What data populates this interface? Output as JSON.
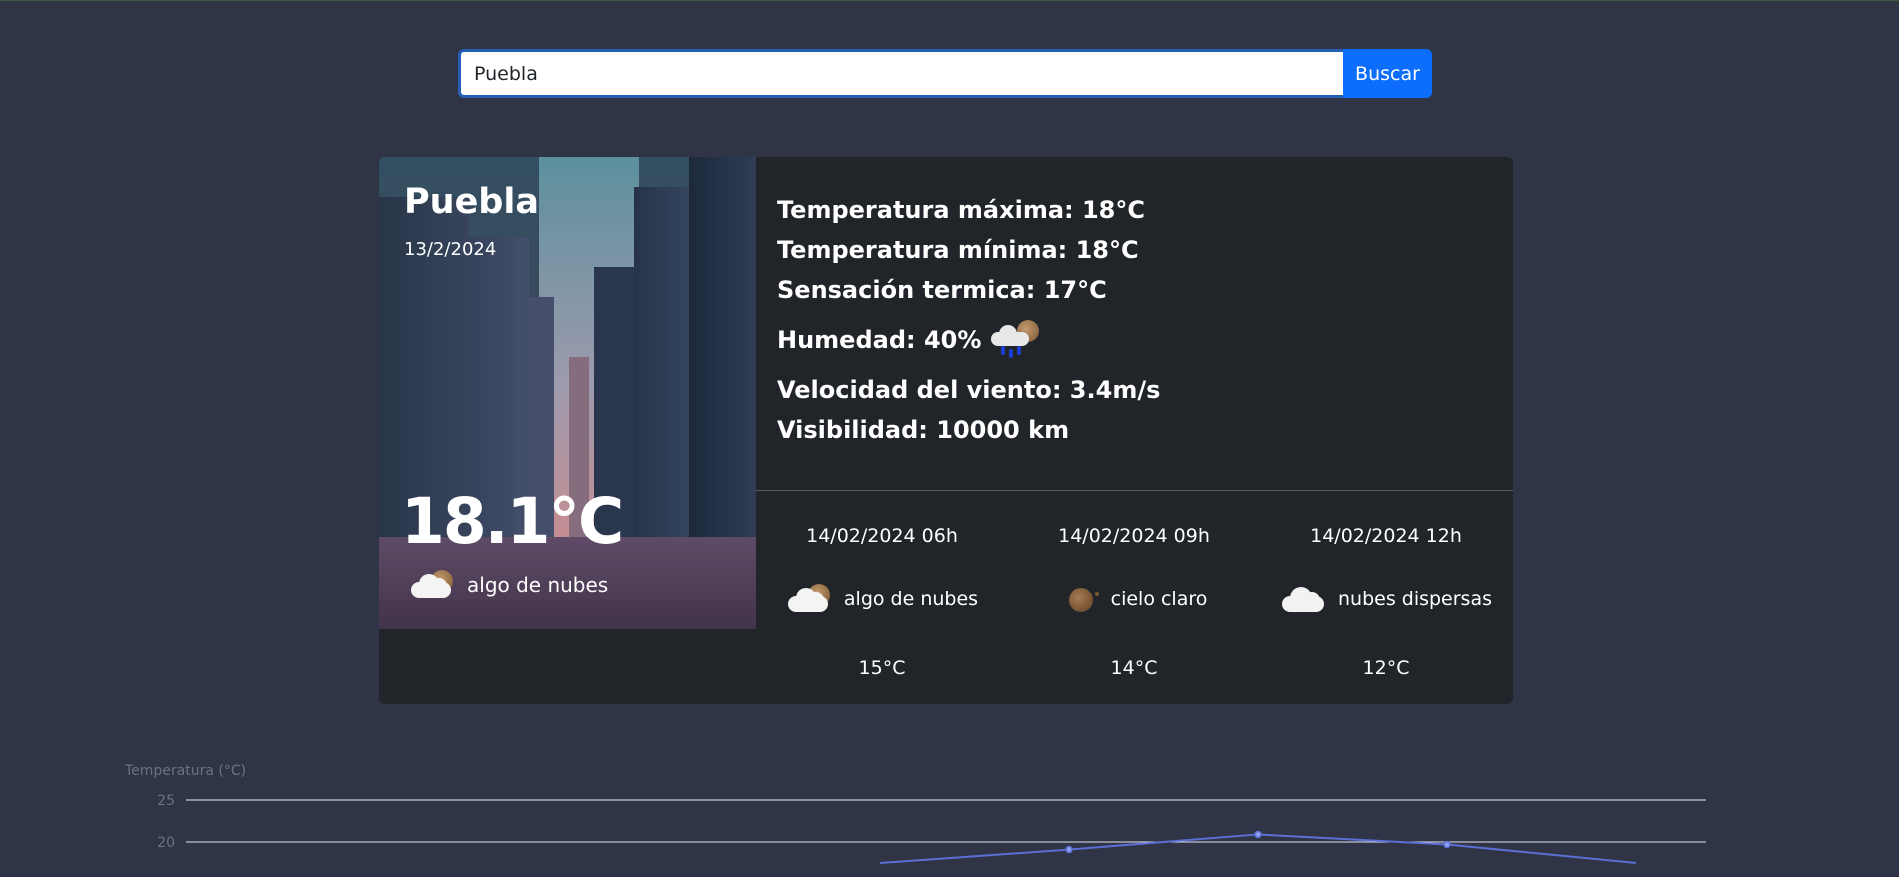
{
  "search": {
    "value": "Puebla",
    "button_label": "Buscar"
  },
  "current": {
    "city": "Puebla",
    "date": "13/2/2024",
    "temperature": "18.1°C",
    "description": "algo de nubes",
    "icon": "cloud-sun-icon"
  },
  "details": {
    "max_temp": "Temperatura máxima: 18°C",
    "min_temp": "Temperatura mínima: 18°C",
    "feels_like": "Sensación termica: 17°C",
    "humidity": "Humedad: 40%",
    "humidity_icon": "rain-cloud-icon",
    "wind": "Velocidad del viento: 3.4m/s",
    "visibility": "Visibilidad: 10000 km"
  },
  "forecast": [
    {
      "datetime": "14/02/2024 06h",
      "description": "algo de nubes",
      "icon": "cloud-sun-icon",
      "temp": "15°C"
    },
    {
      "datetime": "14/02/2024 09h",
      "description": "cielo claro",
      "icon": "sun-icon",
      "temp": "14°C"
    },
    {
      "datetime": "14/02/2024 12h",
      "description": "nubes dispersas",
      "icon": "cloud-icon",
      "temp": "12°C"
    }
  ],
  "colors": {
    "background": "#2f3546",
    "card": "#212529",
    "accent": "#0d6efd",
    "chart_line": "#5b6fd6"
  },
  "chart_data": {
    "type": "line",
    "ylabel": "Temperatura (°C)",
    "y_ticks": [
      25,
      20
    ],
    "ylim": [
      17,
      25
    ],
    "x": [
      1,
      2,
      3,
      4,
      5
    ],
    "values": [
      17.5,
      19.1,
      20.9,
      19.7,
      17.5
    ],
    "grid": true
  }
}
